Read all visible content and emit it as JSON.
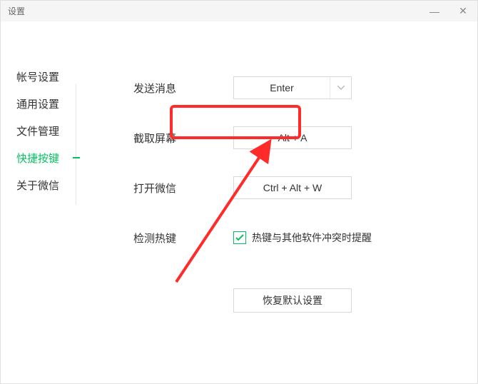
{
  "window": {
    "title": "设置"
  },
  "sidebar": {
    "items": [
      {
        "label": "帐号设置"
      },
      {
        "label": "通用设置"
      },
      {
        "label": "文件管理"
      },
      {
        "label": "快捷按键"
      },
      {
        "label": "关于微信"
      }
    ],
    "active_index": 3
  },
  "settings": {
    "send_label": "发送消息",
    "send_value": "Enter",
    "capture_label": "截取屏幕",
    "capture_value": "Alt + A",
    "open_label": "打开微信",
    "open_value": "Ctrl + Alt + W",
    "detect_label": "检测热键",
    "detect_checkbox_label": "热键与其他软件冲突时提醒",
    "detect_checked": true,
    "restore_label": "恢复默认设置"
  },
  "annotation": {
    "highlight_color": "#ff2a2a"
  }
}
